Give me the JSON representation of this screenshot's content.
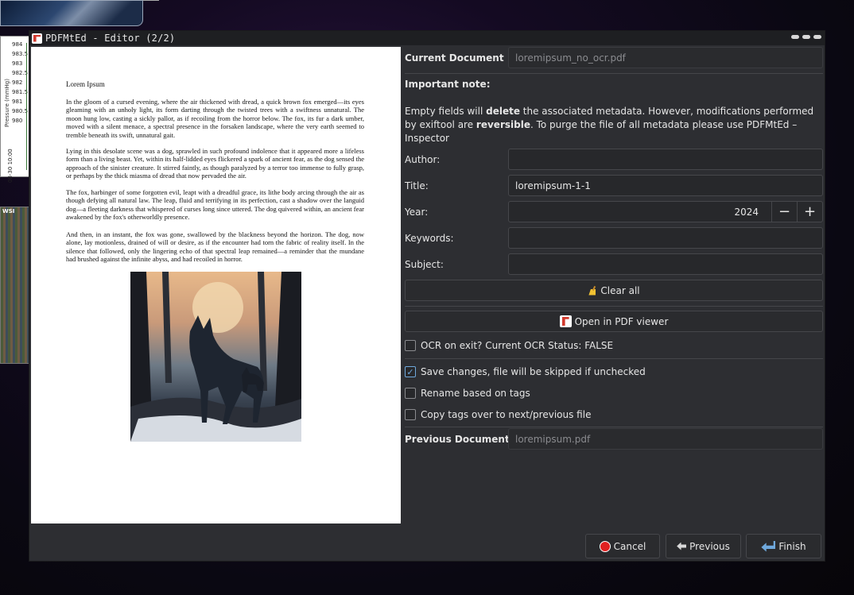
{
  "background": {
    "chart": {
      "ylabel": "Pressure (mmHg)",
      "ticks": [
        "984",
        "983.5",
        "983",
        "982.5",
        "982",
        "981.5",
        "981",
        "980.5",
        "980"
      ],
      "xlabel": "08-30 10:00"
    },
    "map_tag": "WSI"
  },
  "window": {
    "title": "PDFMtEd - Editor (2/2)"
  },
  "preview": {
    "doc_title": "Lorem Ipsum",
    "paragraphs": [
      "In the gloom of a cursed evening, where the air thickened with dread, a quick brown fox emerged—its eyes gleaming with an unholy light, its form darting through the twisted trees with a swiftness unnatural. The moon hung low, casting a sickly pallor, as if recoiling from the horror below. The fox, its fur a dark umber, moved with a silent menace, a spectral presence in the forsaken landscape, where the very earth seemed to tremble beneath its swift, unnatural gait.",
      "Lying in this desolate scene was a dog, sprawled in such profound indolence that it appeared more a lifeless form than a living beast. Yet, within its half-lidded eyes flickered a spark of ancient fear, as the dog sensed the approach of the sinister creature. It stirred faintly, as though paralyzed by a terror too immense to fully grasp, or perhaps by the thick miasma of dread that now pervaded the air.",
      "The fox, harbinger of some forgotten evil, leapt with a dreadful grace, its lithe body arcing through the air as though defying all natural law. The leap, fluid and terrifying in its perfection, cast a shadow over the languid dog—a fleeting darkness that whispered of curses long since uttered. The dog quivered within, an ancient fear awakened by the fox's otherworldly presence.",
      "And then, in an instant, the fox was gone, swallowed by the blackness beyond the horizon. The dog, now alone, lay motionless, drained of will or desire, as if the encounter had torn the fabric of reality itself. In the silence that followed, only the lingering echo of that spectral leap remained—a reminder that the mundane had brushed against the infinite abyss, and had recoiled in horror."
    ]
  },
  "panel": {
    "current_document_label": "Current Document",
    "current_document_value": "loremipsum_no_ocr.pdf",
    "important_note_label": "Important note",
    "note_parts": {
      "p1": "Empty fields will ",
      "b1": "delete",
      "p2": " the associated metadata. However, modifications performed by exiftool are ",
      "b2": "reversible",
      "p3": ". To purge the file of all metadata please use PDFMtEd – Inspector"
    },
    "author_label": "Author:",
    "author_value": "",
    "title_label": "Title:",
    "title_value": "loremipsum-1-1",
    "year_label": "Year:",
    "year_value": "2024",
    "keywords_label": "Keywords:",
    "keywords_value": "",
    "subject_label": "Subject:",
    "subject_value": "",
    "clear_all_label": "Clear all",
    "open_viewer_label": "Open in PDF viewer",
    "ocr_label": "OCR on exit? Current OCR Status: FALSE",
    "ocr_checked": false,
    "save_label": "Save changes, file will be skipped if unchecked",
    "save_checked": true,
    "rename_label": "Rename based on tags",
    "rename_checked": false,
    "copy_label": "Copy tags over to next/previous file",
    "copy_checked": false,
    "previous_document_label": "Previous Document",
    "previous_document_value": "loremipsum.pdf"
  },
  "footer": {
    "cancel_label": "Cancel",
    "previous_label": "Previous",
    "finish_label": "Finish"
  }
}
